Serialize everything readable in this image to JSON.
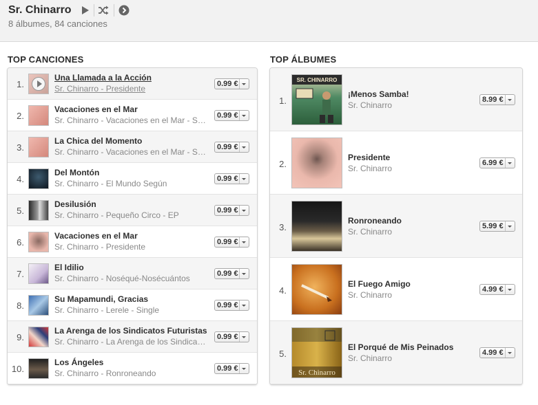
{
  "header": {
    "artist": "Sr. Chinarro",
    "subtitle": "8 álbumes, 84 canciones",
    "icons": [
      "play-icon",
      "shuffle-icon",
      "more-arrow-icon"
    ]
  },
  "top_songs": {
    "title": "TOP CANCIONES",
    "items": [
      {
        "rank": "1.",
        "name": "Una Llamada a la Acción",
        "sub": "Sr. Chinarro - Presidente",
        "price": "0.99 €"
      },
      {
        "rank": "2.",
        "name": "Vacaciones en el Mar",
        "sub": "Sr. Chinarro - Vacaciones en el Mar - Single",
        "price": "0.99 €"
      },
      {
        "rank": "3.",
        "name": "La Chica del Momento",
        "sub": "Sr. Chinarro - Vacaciones en el Mar - Single",
        "price": "0.99 €"
      },
      {
        "rank": "4.",
        "name": "Del Montón",
        "sub": "Sr. Chinarro - El Mundo Según",
        "price": "0.99 €"
      },
      {
        "rank": "5.",
        "name": "Desilusión",
        "sub": "Sr. Chinarro - Pequeño Circo - EP",
        "price": "0.99 €"
      },
      {
        "rank": "6.",
        "name": "Vacaciones en el Mar",
        "sub": "Sr. Chinarro - Presidente",
        "price": "0.99 €"
      },
      {
        "rank": "7.",
        "name": "El Idilio",
        "sub": "Sr. Chinarro - Noséqué-Nosécuántos",
        "price": "0.99 €"
      },
      {
        "rank": "8.",
        "name": "Su Mapamundi, Gracias",
        "sub": "Sr. Chinarro - Lerele - Single",
        "price": "0.99 €"
      },
      {
        "rank": "9.",
        "name": "La Arenga de los Sindicatos Futuristas",
        "sub": "Sr. Chinarro - La Arenga de los Sindicatos Futuristas",
        "price": "0.99 €"
      },
      {
        "rank": "10.",
        "name": "Los Ángeles",
        "sub": "Sr. Chinarro - Ronroneando",
        "price": "0.99 €"
      }
    ]
  },
  "top_albums": {
    "title": "TOP ÁLBUMES",
    "items": [
      {
        "rank": "1.",
        "name": "¡Menos Samba!",
        "sub": "Sr. Chinarro",
        "price": "8.99 €",
        "cover_text": "SR. CHINARRO"
      },
      {
        "rank": "2.",
        "name": "Presidente",
        "sub": "Sr. Chinarro",
        "price": "6.99 €"
      },
      {
        "rank": "3.",
        "name": "Ronroneando",
        "sub": "Sr. Chinarro",
        "price": "5.99 €"
      },
      {
        "rank": "4.",
        "name": "El Fuego Amigo",
        "sub": "Sr. Chinarro",
        "price": "4.99 €"
      },
      {
        "rank": "5.",
        "name": "El Porqué de Mis Peinados",
        "sub": "Sr. Chinarro",
        "price": "4.99 €",
        "cover_text": "Sr. Chinarro"
      }
    ]
  },
  "colors": {
    "header_bg": "#f2f2f2",
    "row_alt": "#f5f5f5",
    "muted_text": "#888888"
  }
}
